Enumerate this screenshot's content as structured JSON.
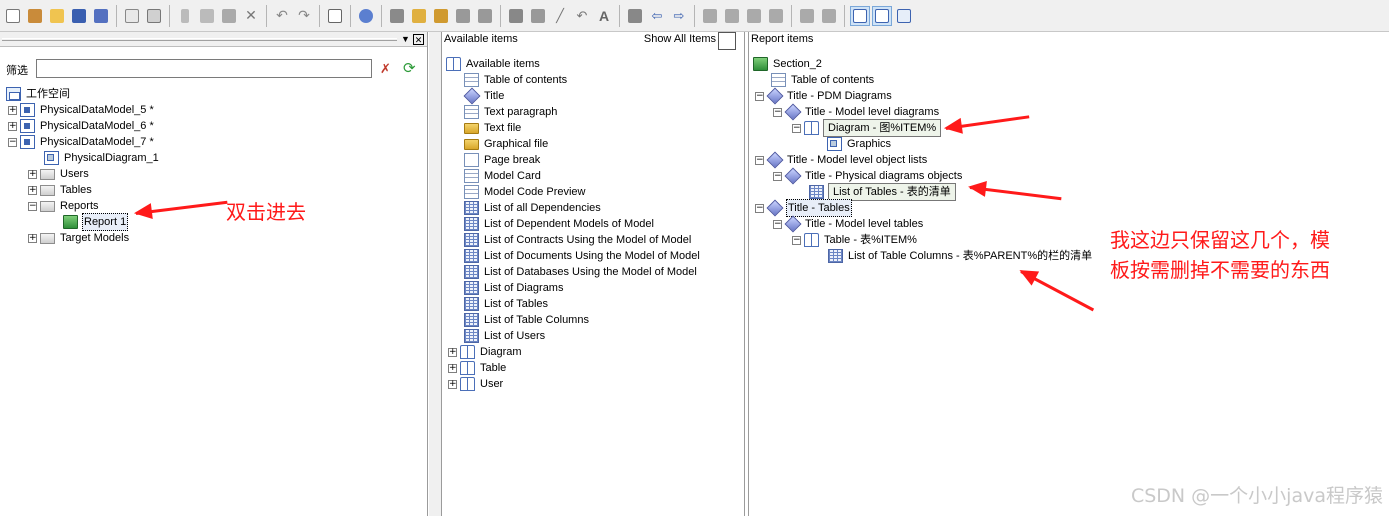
{
  "left_panel": {
    "filter_label": "筛选",
    "filter_value": "",
    "tree": [
      {
        "label": "工作空间",
        "icon": "workspace-icon"
      },
      {
        "label": "PhysicalDataModel_5 *",
        "icon": "model-icon"
      },
      {
        "label": "PhysicalDataModel_6 *",
        "icon": "model-icon"
      },
      {
        "label": "PhysicalDataModel_7 *",
        "icon": "model-icon"
      },
      {
        "label": "PhysicalDiagram_1",
        "icon": "diagram-icon"
      },
      {
        "label": "Users",
        "icon": "folder-icon"
      },
      {
        "label": "Tables",
        "icon": "folder-icon"
      },
      {
        "label": "Reports",
        "icon": "folder-icon"
      },
      {
        "label": "Report 1",
        "icon": "report-icon"
      },
      {
        "label": "Target Models",
        "icon": "folder-icon"
      }
    ]
  },
  "middle_panel": {
    "header": "Available items",
    "show_all_label": "Show All Items",
    "items": [
      "Available items",
      "Table of contents",
      "Title",
      "Text paragraph",
      "Text file",
      "Graphical file",
      "Page break",
      "Model Card",
      "Model Code Preview",
      "List of all Dependencies",
      "List of Dependent Models of Model",
      "List of Contracts Using the Model of Model",
      "List of Documents Using the Model of Model",
      "List of Databases Using the Model of Model",
      "List of Diagrams",
      "List of Tables",
      "List of Table Columns",
      "List of Users",
      "Diagram",
      "Table",
      "User"
    ]
  },
  "right_panel": {
    "header": "Report items",
    "items": [
      "Section_2",
      "Table of contents",
      "Title - PDM Diagrams",
      "Title - Model level diagrams",
      "Diagram - 图%ITEM%",
      "Graphics",
      "Title - Model level object lists",
      "Title - Physical diagrams objects",
      "List of Tables - 表的清单",
      "Title - Tables",
      "Title - Model level tables",
      "Table - 表%ITEM%",
      "List of Table Columns - 表%PARENT%的栏的清单"
    ]
  },
  "annotations": {
    "double_click": "双击进去",
    "note_line1": "我这边只保留这几个，模",
    "note_line2": "板按需删掉不需要的东西"
  },
  "watermark": "CSDN @一个小小java程序猿",
  "colors": {
    "annotation": "#ff1a1a",
    "toolbar": "#f0f0f0",
    "selection": "#e8eef8"
  }
}
